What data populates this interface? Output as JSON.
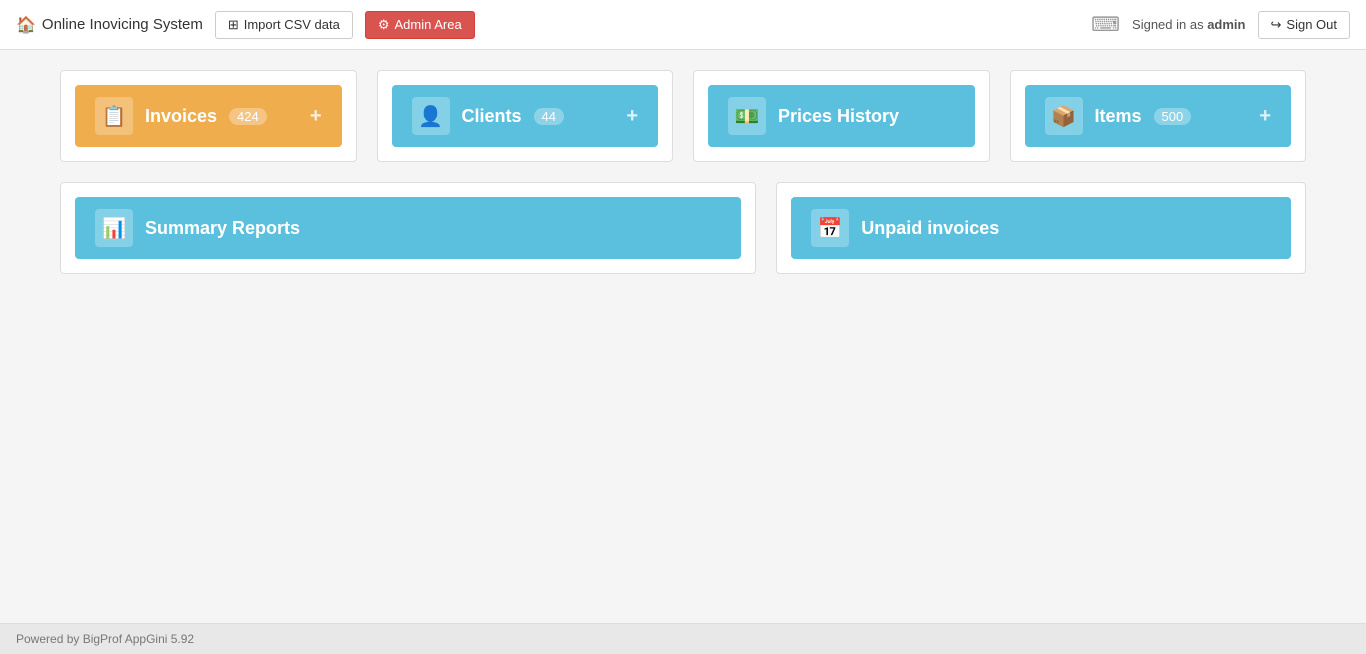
{
  "app": {
    "title": "Online Inovicing System",
    "home_icon": "🏠"
  },
  "navbar": {
    "import_btn": "Import CSV data",
    "import_icon": "⊞",
    "admin_btn": "Admin Area",
    "admin_icon": "⚙",
    "keyboard_icon": "⌨",
    "signed_in_prefix": "Signed in as ",
    "signed_in_user": "admin",
    "signout_btn": "Sign Out",
    "signout_icon": "↪"
  },
  "modules": {
    "invoices": {
      "label": "Invoices",
      "count": "424",
      "icon": "📋"
    },
    "clients": {
      "label": "Clients",
      "count": "44",
      "icon": "👤"
    },
    "prices_history": {
      "label": "Prices History",
      "icon": "💵"
    },
    "items": {
      "label": "Items",
      "count": "500",
      "icon": "📦"
    },
    "summary_reports": {
      "label": "Summary Reports",
      "icon": "📊"
    },
    "unpaid_invoices": {
      "label": "Unpaid invoices",
      "icon": "📅"
    }
  },
  "footer": {
    "text": "Powered by BigProf AppGini 5.92"
  }
}
